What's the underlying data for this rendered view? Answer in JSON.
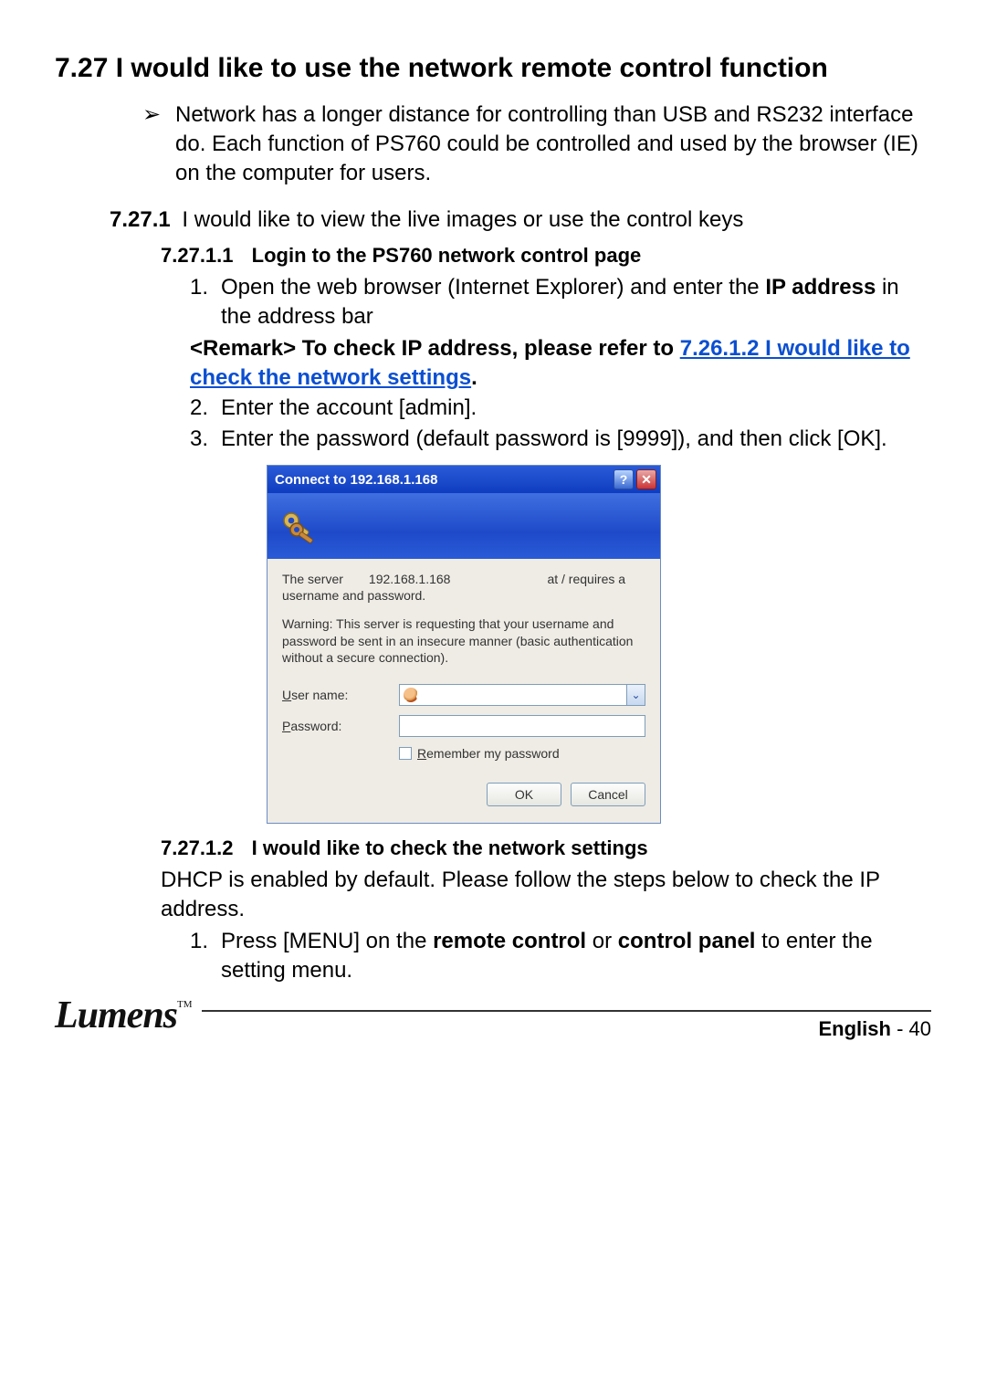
{
  "heading": {
    "num": "7.27",
    "text": "I would like to use the network remote control function"
  },
  "intro_bullet": "Network has a longer distance for controlling than USB and RS232 interface do. Each function of PS760 could be controlled and used by the browser (IE) on the computer for users.",
  "sub1": {
    "num": "7.27.1",
    "text": "I would like to view the live images or use the control keys"
  },
  "sub1_1": {
    "num": "7.27.1.1",
    "text": "Login to the PS760 network control page"
  },
  "steps_a": {
    "s1_pre": "Open the web browser (Internet Explorer) and enter the ",
    "s1_bold": "IP address",
    "s1_post": " in the address bar",
    "remark_pre": "<Remark> To check IP address, please refer to ",
    "remark_link": "7.26.1.2 I would like to check the network settings",
    "remark_post": ".",
    "s2": "Enter the account [admin].",
    "s3": "Enter the password (default password is [9999]), and then click [OK]."
  },
  "dialog": {
    "title": "Connect to 192.168.1.168",
    "help": "?",
    "close": "✕",
    "server_label": "The server",
    "server_ip": "192.168.1.168",
    "server_right": "at / requires a",
    "server_line2": "username and password.",
    "warning": "Warning: This server is requesting that your username and password be sent in an insecure manner (basic authentication without a secure connection).",
    "user_label_pre": "U",
    "user_label_rest": "ser name:",
    "pass_label_pre": "P",
    "pass_label_rest": "assword:",
    "remember_pre": "R",
    "remember_rest": "emember my password",
    "ok": "OK",
    "cancel": "Cancel",
    "dd": "⌄"
  },
  "sub1_2": {
    "num": "7.27.1.2",
    "text": "I would like to check the network settings"
  },
  "para1": "DHCP is enabled by default. Please follow the steps below to check the IP address.",
  "steps_b": {
    "s1_pre": "Press [MENU] on the ",
    "s1_b1": "remote control",
    "s1_mid": " or ",
    "s1_b2": "control panel",
    "s1_post": " to enter the setting menu."
  },
  "footer": {
    "logo": "Lumens",
    "tm": "TM",
    "lang": "English",
    "dash": " -  ",
    "page": "40"
  }
}
